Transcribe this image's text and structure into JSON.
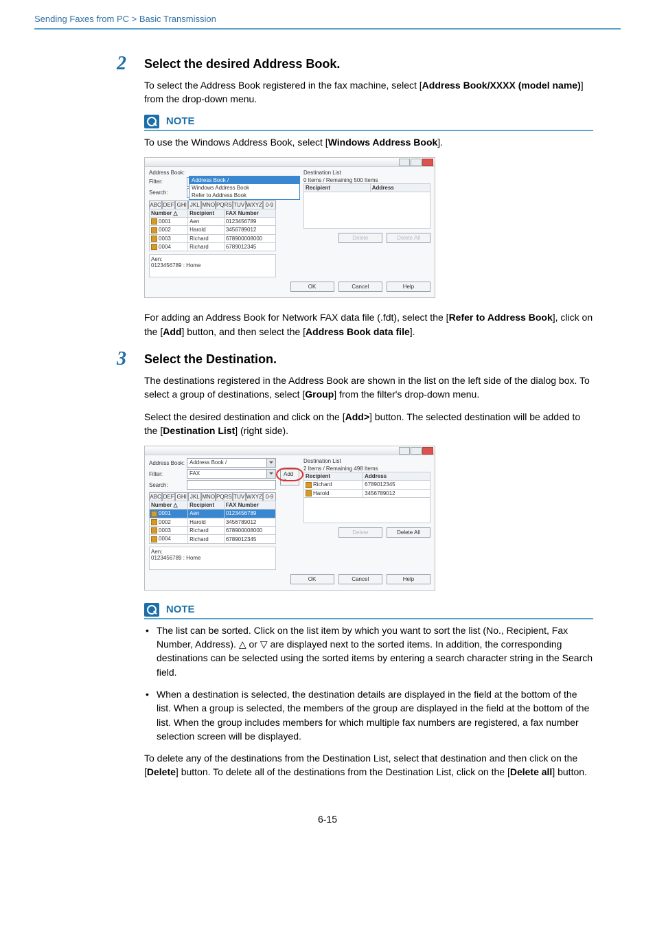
{
  "breadcrumb": "Sending Faxes from PC > Basic Transmission",
  "page_number": "6-15",
  "step2": {
    "num": "2",
    "heading": "Select the desired Address Book.",
    "p1_a": "To select the Address Book registered in the fax machine, select [",
    "p1_b": "Address Book/XXXX (model name)",
    "p1_c": "] from the drop-down menu.",
    "note_label": "NOTE",
    "note_a": "To use the Windows Address Book, select [",
    "note_b": "Windows Address Book",
    "note_c": "].",
    "after_a": "For adding an Address Book for Network FAX data file (.fdt), select the [",
    "after_b": "Refer to Address Book",
    "after_c": "], click on the [",
    "after_d": "Add",
    "after_e": "] button, and then select the [",
    "after_f": "Address Book data file",
    "after_g": "]."
  },
  "step3": {
    "num": "3",
    "heading": "Select the Destination.",
    "p1_a": "The destinations registered in the Address Book are shown in the list on the left side of the dialog box. To select a group of destinations, select [",
    "p1_b": "Group",
    "p1_c": "] from the filter's drop-down menu.",
    "p2_a": "Select the desired destination and click on the [",
    "p2_b": "Add>",
    "p2_c": "] button. The selected destination will be added to the [",
    "p2_d": "Destination List",
    "p2_e": "] (right side).",
    "note_label": "NOTE",
    "note_li1": "The list can be sorted. Click on the list item by which you want to sort the list (No., Recipient, Fax Number, Address). △ or ▽ are displayed next to the sorted items. In addition, the corresponding destinations can be selected using the sorted items by entering a search character string in the Search field.",
    "note_li2": "When a destination is selected, the destination details are displayed in the field at the bottom of the list. When a group is selected, the members of the group are displayed in the field at the bottom of the list. When the group includes members for which multiple fax numbers are registered, a fax number selection screen will be displayed.",
    "after_a": "To delete any of the destinations from the Destination List, select that destination and then click on the [",
    "after_b": "Delete",
    "after_c": "] button. To delete all of the destinations from the Destination List, click on the [",
    "after_d": "Delete all",
    "after_e": "] button."
  },
  "dialog": {
    "lbl_address_book": "Address Book:",
    "lbl_filter": "Filter:",
    "lbl_search": "Search:",
    "lbl_dest_list": "Destination List",
    "filter_value": "FAX",
    "ab_value": "Address Book /",
    "dd_opts": {
      "sel": "Address Book /",
      "o1": "Windows Address Book",
      "o2": "Refer to Address Book"
    },
    "tabs": {
      "abc": "ABC",
      "def": "DEF",
      "ghi": "GHI",
      "jkl": "JKL",
      "mno": "MNO",
      "pqrs": "PQRS",
      "tuv": "TUV",
      "wxyz": "WXYZ",
      "num": "0-9"
    },
    "cols": {
      "num": "Number △",
      "rec": "Recipient",
      "fax": "FAX Number",
      "addr": "Address"
    },
    "remaining0": "0 Items / Remaining 500 Items",
    "remaining2": "2 Items / Remaining 498 Items",
    "rows": [
      {
        "n": "0001",
        "r": "Aen",
        "f": "0123456789"
      },
      {
        "n": "0002",
        "r": "Harold",
        "f": "3456789012"
      },
      {
        "n": "0003",
        "r": "Richard",
        "f": "678900008000"
      },
      {
        "n": "0004",
        "r": "Richard",
        "f": "6789012345"
      }
    ],
    "dest2": [
      {
        "r": "Richard",
        "a": "6789012345"
      },
      {
        "r": "Harold",
        "a": "3456789012"
      }
    ],
    "detail_name": "Aen:",
    "detail_line": "0123456789 : Home",
    "btn_add": "Add >",
    "btn_delete": "Delete",
    "btn_delete_all": "Delete All",
    "btn_ok": "OK",
    "btn_cancel": "Cancel",
    "btn_help": "Help"
  }
}
